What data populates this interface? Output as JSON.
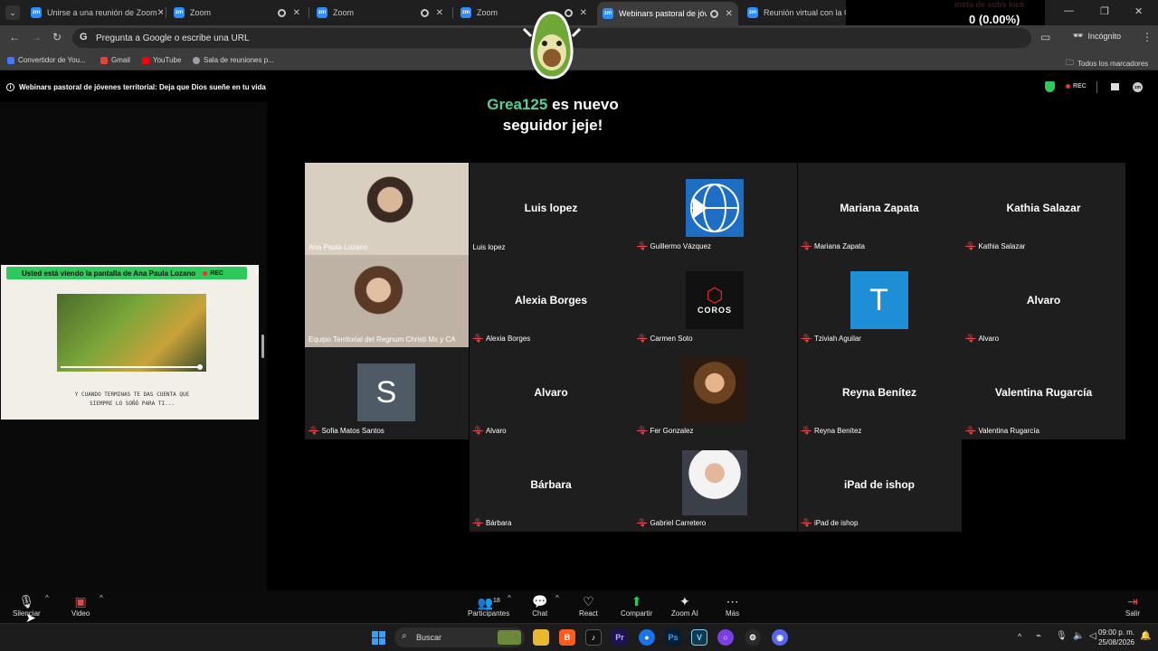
{
  "browser": {
    "tabs": [
      {
        "title": "Unirse a una reunión de Zoom",
        "favicon": "zm"
      },
      {
        "title": "Zoom",
        "favicon": "zm"
      },
      {
        "title": "Zoom",
        "favicon": "zm"
      },
      {
        "title": "Zoom",
        "favicon": "zm"
      },
      {
        "title": "Webinars pastoral de jóvenes",
        "favicon": "zm"
      },
      {
        "title": "Reunión virtual con la Comunic",
        "favicon": "zm"
      }
    ],
    "new_tab": "+",
    "address_placeholder": "Pregunta a Google o escribe una URL",
    "incognito_label": "Incógnito",
    "bookmarks": [
      {
        "label": "Convertidor de You...",
        "color": "#3b7bff"
      },
      {
        "label": "Gmail",
        "color": "#ea4335"
      },
      {
        "label": "YouTube",
        "color": "#ff0000"
      },
      {
        "label": "Sala de reuniones p...",
        "color": "#9aa0a6"
      }
    ],
    "all_bookmarks": "Todos los marcadores"
  },
  "overlay": {
    "goal_title": "meta de subs kick",
    "goal_value": "0 (0.00%)",
    "goal_count": "0",
    "follower_nick": "Grea125",
    "follower_line1_rest": " es nuevo",
    "follower_line2": "seguidor jeje!"
  },
  "zoom": {
    "meeting_title": "Webinars pastoral de jóvenes territorial: Deja que Dios sueñe en tu vida",
    "rec_label": "REC",
    "share": {
      "banner_text": "Usted está viendo la pantalla de  Ana Paula Lozano",
      "rec_label": "REC",
      "caption_line1": "Y CUANDO TERMINAS TE DAS CUENTA QUE",
      "caption_line2": "SIEMPRE LO SOÑÓ PARA TI..."
    },
    "participants": [
      {
        "name": "",
        "label": "Ana Paula Lozano",
        "kind": "video",
        "muted": false
      },
      {
        "name": "Luis lopez",
        "label": "Luis lopez",
        "kind": "name",
        "muted": false
      },
      {
        "name": "",
        "label": "Guillermo Vázquez",
        "kind": "globe",
        "muted": true
      },
      {
        "name": "Mariana Zapata",
        "label": "Mariana Zapata",
        "kind": "name",
        "muted": true
      },
      {
        "name": "Kathia Salazar",
        "label": "Kathia Salazar",
        "kind": "name",
        "muted": true
      },
      {
        "name": "",
        "label": "Equipo Territorial del Regnum Christi Mx y CA",
        "kind": "video",
        "muted": false
      },
      {
        "name": "Alexia Borges",
        "label": "Alexia Borges",
        "kind": "name",
        "muted": true
      },
      {
        "name": "COROS",
        "label": "Carmen Soto",
        "kind": "coros",
        "muted": true
      },
      {
        "name": "T",
        "label": "Tziviah Aguilar",
        "kind": "letter",
        "muted": true
      },
      {
        "name": "Alvaro",
        "label": "Alvaro",
        "kind": "name",
        "muted": true
      },
      {
        "name": "S",
        "label": "Sofia Matos Santos",
        "kind": "letter-s",
        "muted": true
      },
      {
        "name": "Alvaro",
        "label": "Alvaro",
        "kind": "name",
        "muted": true
      },
      {
        "name": "",
        "label": "Fer Gonzalez",
        "kind": "photo",
        "muted": true
      },
      {
        "name": "Reyna Benítez",
        "label": "Reyna Benítez",
        "kind": "name",
        "muted": true
      },
      {
        "name": "Valentina Rugarcía",
        "label": "Valentina Rugarcía",
        "kind": "name",
        "muted": true
      },
      {
        "name": "Bárbara",
        "label": "Bárbara",
        "kind": "name",
        "muted": true
      },
      {
        "name": "",
        "label": "Gabriel Carretero",
        "kind": "photo2",
        "muted": true
      },
      {
        "name": "iPad de ishop",
        "label": "iPad de ishop",
        "kind": "name",
        "muted": true
      }
    ],
    "toolbar": {
      "mute_label": "Silenciar",
      "video_label": "Video",
      "participants_label": "Participantes",
      "participants_count": "18",
      "chat_label": "Chat",
      "react_label": "React",
      "share_label": "Compartir",
      "ai_label": "Zoom AI",
      "more_label": "Más",
      "leave_label": "Salir"
    }
  },
  "taskbar": {
    "search_label": "Buscar",
    "time": "09:00 p. m.",
    "date": "25/08/2026"
  }
}
